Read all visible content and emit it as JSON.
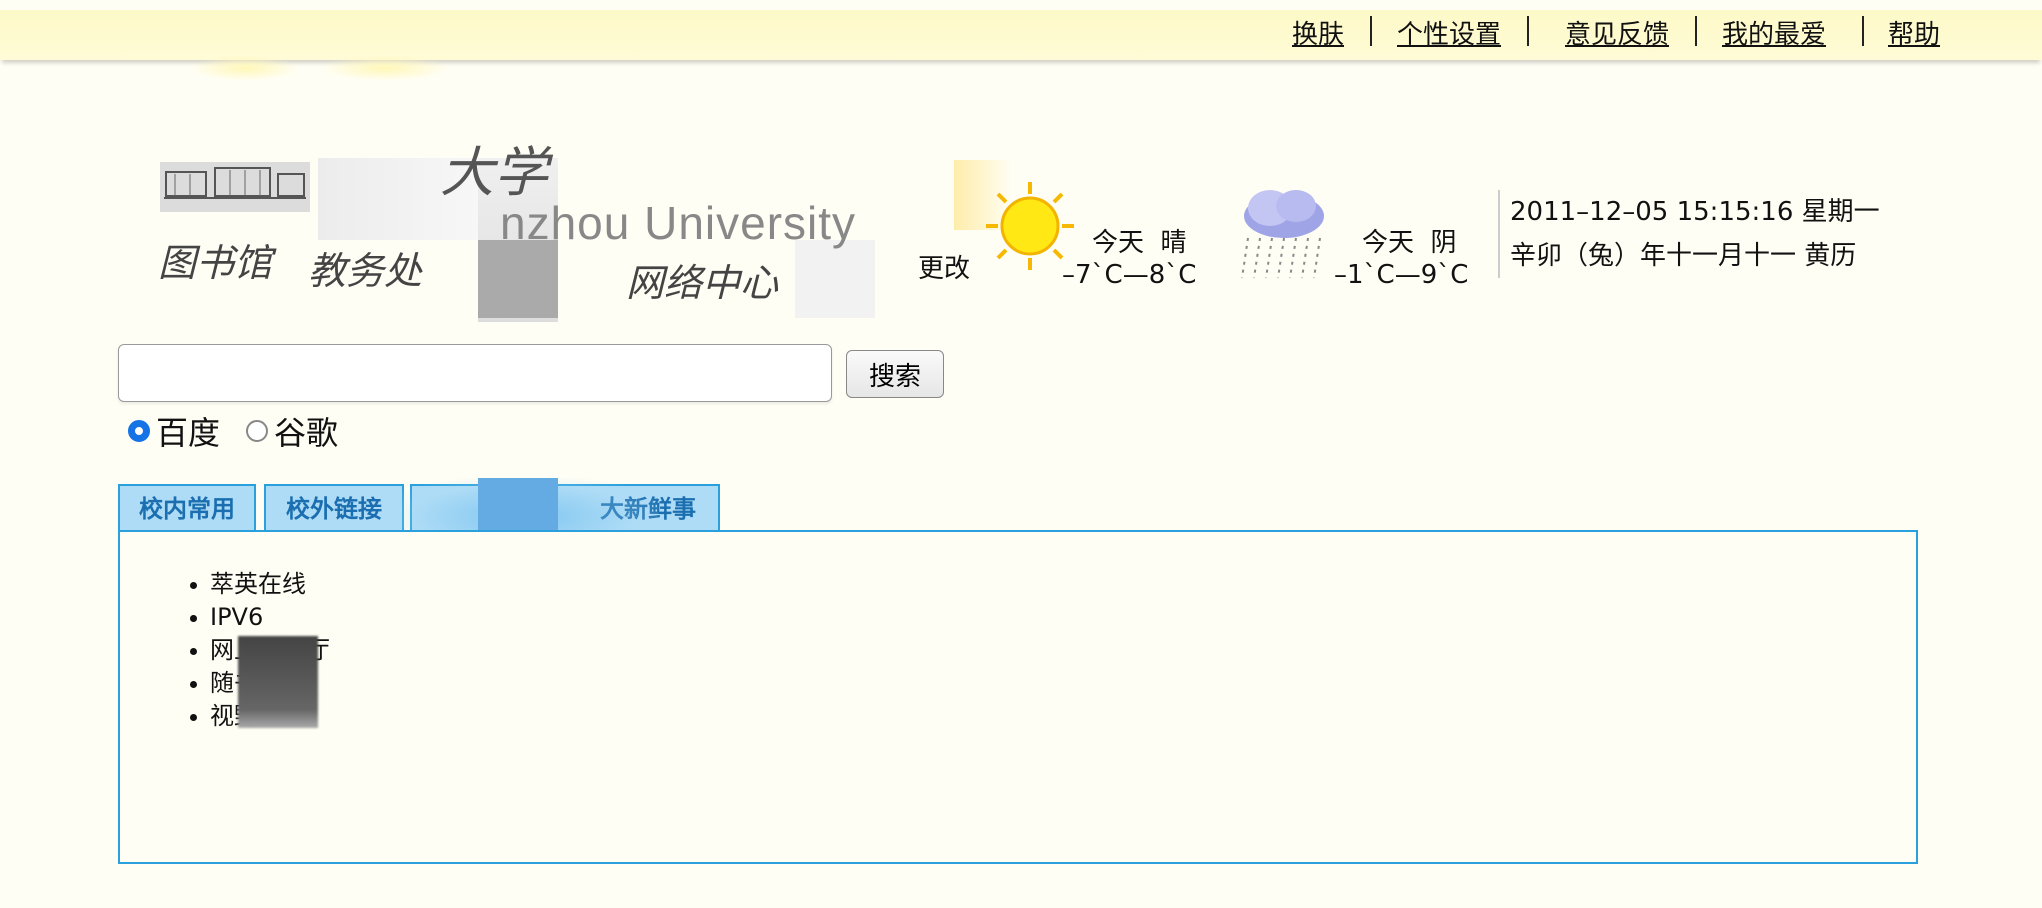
{
  "topbar": {
    "links": [
      "换肤",
      "个性设置",
      "意见反馈",
      "我的最爱",
      "帮助"
    ]
  },
  "logo": {
    "calligraphy": "大学",
    "english_visible": "nzhou University",
    "quick_links": [
      "图书馆",
      "教务处",
      "网络中心"
    ]
  },
  "weather": {
    "change_label": "更改",
    "today1": {
      "label": "今天",
      "condition": "晴",
      "temp": "–7`C—8`C",
      "icon": "sun-icon"
    },
    "today2": {
      "label": "今天",
      "condition": "阴",
      "temp": "–1`C—9`C",
      "icon": "rain-cloud-icon"
    }
  },
  "datetime": {
    "line1": "2011–12–05 15:15:16 星期一",
    "line2": "辛卯（兔）年十一月十一 黄历"
  },
  "search": {
    "value": "",
    "button": "搜索",
    "engines": [
      {
        "label": "百度",
        "selected": true
      },
      {
        "label": "谷歌",
        "selected": false
      }
    ]
  },
  "tabs": [
    "校内常用",
    "校外链接",
    "大新鲜事"
  ],
  "links": [
    "萃英在线",
    "IPV6",
    "网上报告厅",
    "随书光盘",
    "视野"
  ],
  "colors": {
    "accent": "#2aa1dd",
    "tab_bg": "#aedcf6",
    "tab_text": "#1b6fb0",
    "topbar": "#fdfac8",
    "radio": "#1673e6"
  }
}
